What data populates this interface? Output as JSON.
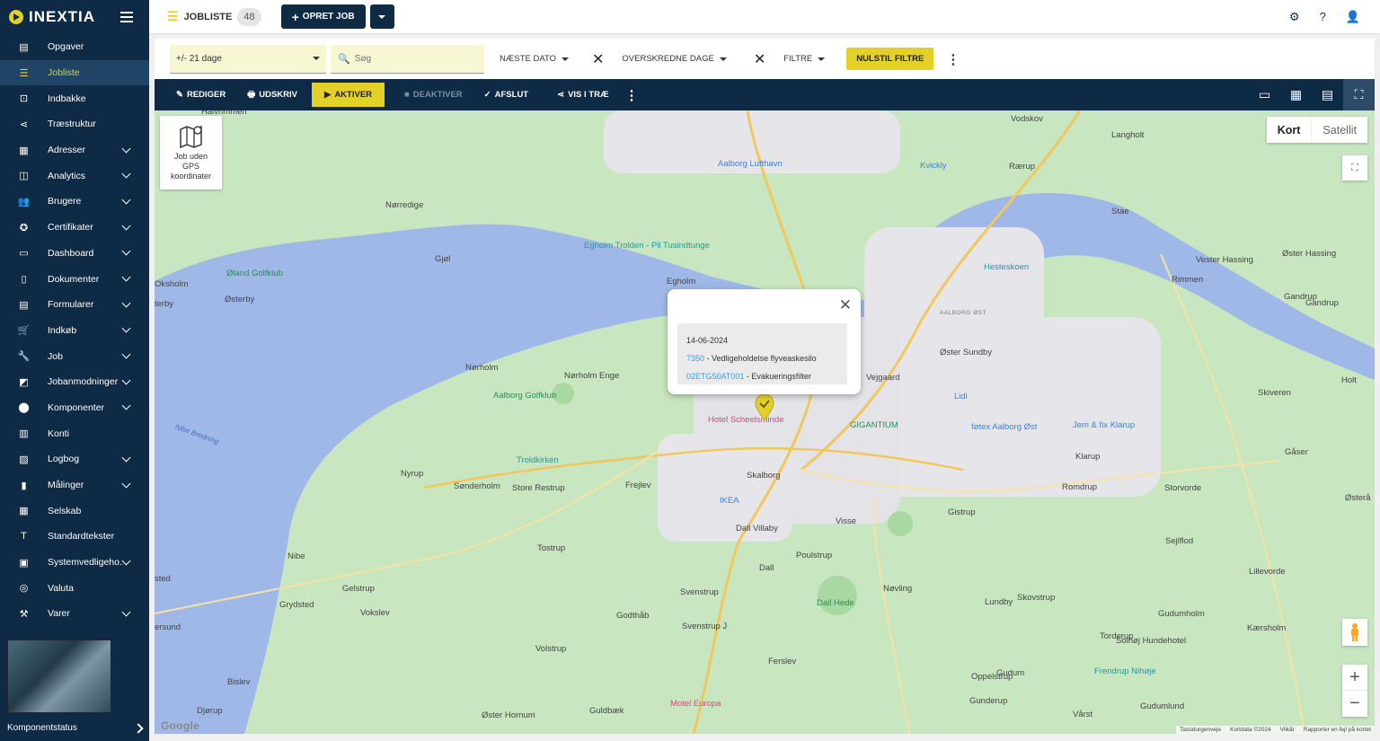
{
  "brand": {
    "name": "INEXTIA"
  },
  "sidebar": {
    "items": [
      {
        "label": "Opgaver",
        "icon": "tasks-icon",
        "expand": false,
        "active": false
      },
      {
        "label": "Jobliste",
        "icon": "list-icon",
        "expand": false,
        "active": true
      },
      {
        "label": "Indbakke",
        "icon": "inbox-icon",
        "expand": false,
        "active": false
      },
      {
        "label": "Træstruktur",
        "icon": "tree-icon",
        "expand": false,
        "active": false
      },
      {
        "label": "Adresser",
        "icon": "address-icon",
        "expand": true,
        "active": false
      },
      {
        "label": "Analytics",
        "icon": "analytics-icon",
        "expand": true,
        "active": false
      },
      {
        "label": "Brugere",
        "icon": "users-icon",
        "expand": true,
        "active": false
      },
      {
        "label": "Certifikater",
        "icon": "certificate-icon",
        "expand": true,
        "active": false
      },
      {
        "label": "Dashboard",
        "icon": "dashboard-icon",
        "expand": true,
        "active": false
      },
      {
        "label": "Dokumenter",
        "icon": "document-icon",
        "expand": true,
        "active": false
      },
      {
        "label": "Formularer",
        "icon": "form-icon",
        "expand": true,
        "active": false
      },
      {
        "label": "Indkøb",
        "icon": "cart-icon",
        "expand": true,
        "active": false
      },
      {
        "label": "Job",
        "icon": "wrench-icon",
        "expand": true,
        "active": false
      },
      {
        "label": "Jobanmodninger",
        "icon": "request-icon",
        "expand": true,
        "active": false
      },
      {
        "label": "Komponenter",
        "icon": "component-icon",
        "expand": true,
        "active": false
      },
      {
        "label": "Konti",
        "icon": "accounts-icon",
        "expand": false,
        "active": false
      },
      {
        "label": "Logbog",
        "icon": "logbook-icon",
        "expand": true,
        "active": false
      },
      {
        "label": "Målinger",
        "icon": "measurement-icon",
        "expand": true,
        "active": false
      },
      {
        "label": "Selskab",
        "icon": "company-icon",
        "expand": false,
        "active": false
      },
      {
        "label": "Standardtekster",
        "icon": "text-icon",
        "expand": false,
        "active": false
      },
      {
        "label": "Systemvedligeho...",
        "icon": "system-icon",
        "expand": true,
        "active": false
      },
      {
        "label": "Valuta",
        "icon": "currency-icon",
        "expand": false,
        "active": false
      },
      {
        "label": "Varer",
        "icon": "hammer-icon",
        "expand": true,
        "active": false
      }
    ],
    "footer_label": "Komponentstatus"
  },
  "header": {
    "title": "JOBLISTE",
    "count": "48",
    "create_label": "OPRET JOB"
  },
  "filters": {
    "range_value": "+/- 21 dage",
    "search_placeholder": "Søg",
    "next_date_label": "NÆSTE DATO",
    "overdue_label": "OVERSKREDNE DAGE",
    "filter_label": "FILTRE",
    "reset_label": "NULSTIL FILTRE"
  },
  "actions": {
    "edit": "REDIGER",
    "print": "UDSKRIV",
    "activate": "AKTIVER",
    "deactivate": "DEAKTIVER",
    "finish": "AFSLUT",
    "show_tree": "VIS I TRÆ"
  },
  "map": {
    "gps_label": "Job uden GPS koordinater",
    "type_map": "Kort",
    "type_satellite": "Satellit",
    "popup": {
      "date": "14-06-2024",
      "job_id": "7350",
      "job_title": "Vedligeholdelse flyveaskesilo",
      "component_id": "02ETG50AT001",
      "component_name": "Evakueringsfilter"
    },
    "attribution": [
      "Tastaturgenveje",
      "Kortdata ©2024",
      "Vilkår",
      "Rapporter en fejl på kortet"
    ],
    "google": "Google",
    "places": [
      {
        "t": "Halvrimmen",
        "c": ""
      },
      {
        "t": "Vejgaard",
        "c": ""
      },
      {
        "t": "Vodskov",
        "c": ""
      },
      {
        "t": "Langholt",
        "c": ""
      },
      {
        "t": "Aalborg Lufthavn",
        "c": "blue"
      },
      {
        "t": "Kvickly",
        "c": "blue"
      },
      {
        "t": "Rærup",
        "c": ""
      },
      {
        "t": "Nørredige",
        "c": ""
      },
      {
        "t": "Stae",
        "c": ""
      },
      {
        "t": "Gjøl",
        "c": ""
      },
      {
        "t": "Egholm Trolden - Pil Tusindtunge",
        "c": "teal"
      },
      {
        "t": "Øland Golfklub",
        "c": "green"
      },
      {
        "t": "Egholm",
        "c": ""
      },
      {
        "t": "Hesteskoen",
        "c": "teal"
      },
      {
        "t": "Vester Hassing",
        "c": ""
      },
      {
        "t": "Øster Hassing",
        "c": ""
      },
      {
        "t": "Oksholm",
        "c": ""
      },
      {
        "t": "Østerby",
        "c": ""
      },
      {
        "t": "Rimmen",
        "c": ""
      },
      {
        "t": "Gandrup",
        "c": ""
      },
      {
        "t": "AALBORG ØST",
        "c": "small"
      },
      {
        "t": "Øster Sundby",
        "c": ""
      },
      {
        "t": "Nørholm",
        "c": ""
      },
      {
        "t": "Nørholm Enge",
        "c": ""
      },
      {
        "t": "Aalborg Golfklub",
        "c": "green"
      },
      {
        "t": "Lidl",
        "c": "blue"
      },
      {
        "t": "Skiveren",
        "c": ""
      },
      {
        "t": "Hotel Scheelsminde",
        "c": "pink"
      },
      {
        "t": "GIGANTIUM",
        "c": "green"
      },
      {
        "t": "føtex Aalborg Øst",
        "c": "blue"
      },
      {
        "t": "Jem & fix Klarup",
        "c": "blue"
      },
      {
        "t": "Klarup",
        "c": ""
      },
      {
        "t": "Gåser",
        "c": ""
      },
      {
        "t": "Troldkirken",
        "c": "teal"
      },
      {
        "t": "Skalborg",
        "c": ""
      },
      {
        "t": "Frejlev",
        "c": ""
      },
      {
        "t": "Nyrup",
        "c": ""
      },
      {
        "t": "Sønderholm",
        "c": ""
      },
      {
        "t": "Store Restrup",
        "c": ""
      },
      {
        "t": "IKEA",
        "c": "blue"
      },
      {
        "t": "Romdrup",
        "c": ""
      },
      {
        "t": "Storvorde",
        "c": ""
      },
      {
        "t": "Visse",
        "c": ""
      },
      {
        "t": "Dall Villaby",
        "c": ""
      },
      {
        "t": "Gistrup",
        "c": ""
      },
      {
        "t": "Sejlflod",
        "c": ""
      },
      {
        "t": "Tostrup",
        "c": ""
      },
      {
        "t": "Nibe",
        "c": ""
      },
      {
        "t": "Poulstrup",
        "c": ""
      },
      {
        "t": "Dall",
        "c": ""
      },
      {
        "t": "Lillevorde",
        "c": ""
      },
      {
        "t": "Gelstrup",
        "c": ""
      },
      {
        "t": "Svenstrup",
        "c": ""
      },
      {
        "t": "Nøvling",
        "c": ""
      },
      {
        "t": "Dall Hede",
        "c": "green"
      },
      {
        "t": "Skovstrup",
        "c": ""
      },
      {
        "t": "Grydsted",
        "c": ""
      },
      {
        "t": "Vokslev",
        "c": ""
      },
      {
        "t": "Godthåb",
        "c": ""
      },
      {
        "t": "Lundby",
        "c": ""
      },
      {
        "t": "Gudumholm",
        "c": ""
      },
      {
        "t": "Svenstrup J",
        "c": ""
      },
      {
        "t": "Torderup",
        "c": ""
      },
      {
        "t": "Solhøj Hundehotel",
        "c": ""
      },
      {
        "t": "Kærsholm",
        "c": ""
      },
      {
        "t": "Volstrup",
        "c": ""
      },
      {
        "t": "Frendrup Nihøje",
        "c": "teal"
      },
      {
        "t": "Ferslev",
        "c": ""
      },
      {
        "t": "Gudum",
        "c": ""
      },
      {
        "t": "Oppelstrup",
        "c": ""
      },
      {
        "t": "Bislev",
        "c": ""
      },
      {
        "t": "Gunderup",
        "c": ""
      },
      {
        "t": "Motel Europa",
        "c": "pink"
      },
      {
        "t": "Gudumlund",
        "c": ""
      },
      {
        "t": "Djørup",
        "c": ""
      },
      {
        "t": "Guldbæk",
        "c": ""
      },
      {
        "t": "Øster Hornum",
        "c": ""
      },
      {
        "t": "Vårst",
        "c": ""
      },
      {
        "t": "Nibe Bredning",
        "c": "river"
      },
      {
        "t": "Holt",
        "c": ""
      },
      {
        "t": "Gandrup",
        "c": ""
      },
      {
        "t": "Østerå",
        "c": ""
      },
      {
        "t": "sted",
        "c": ""
      },
      {
        "t": "ersund",
        "c": ""
      },
      {
        "t": "terby",
        "c": ""
      }
    ]
  }
}
